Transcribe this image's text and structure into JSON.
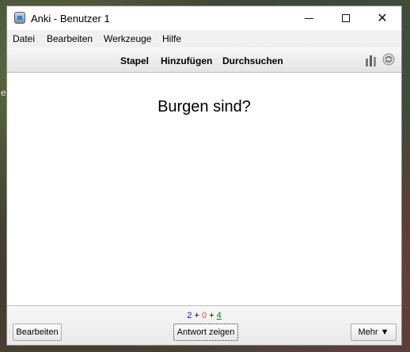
{
  "desktop": {
    "fragment_text": "e"
  },
  "window": {
    "title": "Anki - Benutzer 1",
    "app_icon": "anki-app-icon"
  },
  "controls": {
    "minimize_icon": "minimize-icon",
    "maximize_icon": "maximize-icon",
    "close_icon": "close-icon",
    "close_glyph": "✕"
  },
  "menu": {
    "items": [
      "Datei",
      "Bearbeiten",
      "Werkzeuge",
      "Hilfe"
    ]
  },
  "toolbar": {
    "links": [
      "Stapel",
      "Hinzufügen",
      "Durchsuchen"
    ],
    "stats_icon": "stats-bar-chart-icon",
    "sync_icon": "sync-icon"
  },
  "card": {
    "question": "Burgen sind?"
  },
  "counts": {
    "new": "2",
    "plus1": "+",
    "learn": "0",
    "plus2": "+",
    "review": "4"
  },
  "buttons": {
    "edit": "Bearbeiten",
    "show_answer": "Antwort zeigen",
    "more": "Mehr ▼"
  },
  "colors": {
    "new_count": "#1111cc",
    "learn_count": "#c35617",
    "review_count": "#117711"
  }
}
